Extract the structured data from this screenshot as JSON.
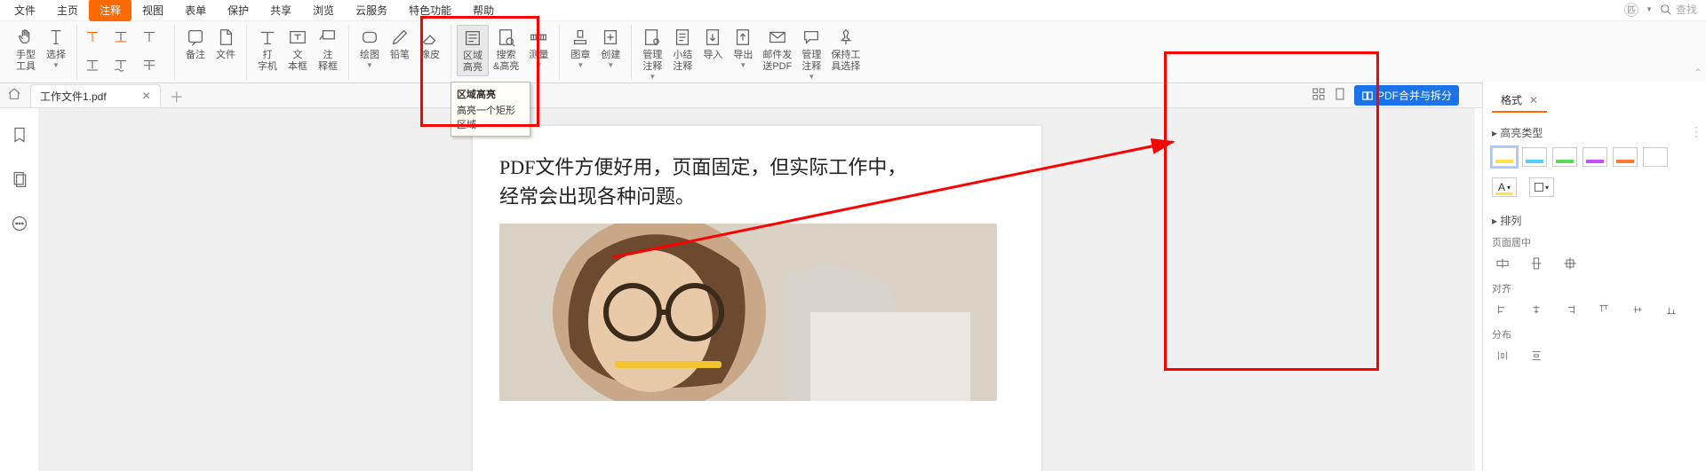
{
  "menu": {
    "items": [
      "文件",
      "主页",
      "注释",
      "视图",
      "表单",
      "保护",
      "共享",
      "浏览",
      "云服务",
      "特色功能",
      "帮助"
    ],
    "active_index": 2
  },
  "search": {
    "placeholder": "查找",
    "zoom_icon_label": "匹"
  },
  "ribbon": {
    "groups": [
      {
        "buttons": [
          {
            "name": "hand-tool",
            "label": "手型\n工具"
          },
          {
            "name": "select-tool",
            "label": "选择",
            "dropdown": true
          }
        ]
      },
      {
        "buttons": [
          {
            "name": "text-highlight-1",
            "label": ""
          },
          {
            "name": "text-highlight-2",
            "label": ""
          },
          {
            "name": "text-highlight-3",
            "label": ""
          },
          {
            "name": "text-underline-1",
            "label": ""
          },
          {
            "name": "text-underline-2",
            "label": ""
          },
          {
            "name": "text-strikethrough",
            "label": ""
          }
        ],
        "compact": true
      },
      {
        "buttons": [
          {
            "name": "note",
            "label": "备注"
          },
          {
            "name": "file-attach",
            "label": "文件"
          }
        ]
      },
      {
        "buttons": [
          {
            "name": "typewriter",
            "label": "打\n字机"
          },
          {
            "name": "textbox",
            "label": "文\n本框"
          },
          {
            "name": "callout",
            "label": "注\n释框"
          }
        ]
      },
      {
        "buttons": [
          {
            "name": "drawing",
            "label": "绘图",
            "dropdown": true
          },
          {
            "name": "pencil",
            "label": "铅笔"
          },
          {
            "name": "eraser",
            "label": "橡皮"
          }
        ]
      },
      {
        "buttons": [
          {
            "name": "area-highlight",
            "label": "区域\n高亮",
            "active": true
          },
          {
            "name": "search-highlight",
            "label": "搜索\n&高亮"
          },
          {
            "name": "measure",
            "label": "测量",
            "dropdown": true
          }
        ]
      },
      {
        "buttons": [
          {
            "name": "stamp",
            "label": "图章",
            "dropdown": true
          },
          {
            "name": "create",
            "label": "创建",
            "dropdown": true
          }
        ]
      },
      {
        "buttons": [
          {
            "name": "manage-comments",
            "label": "管理\n注释",
            "dropdown": true
          },
          {
            "name": "summarize-comments",
            "label": "小结\n注释"
          },
          {
            "name": "import",
            "label": "导入"
          },
          {
            "name": "export",
            "label": "导出",
            "dropdown": true
          },
          {
            "name": "email-pdf",
            "label": "邮件发\n送PDF"
          },
          {
            "name": "manage-comments-2",
            "label": "管理\n注释",
            "dropdown": true
          },
          {
            "name": "keep-tool",
            "label": "保持工\n具选择"
          }
        ]
      }
    ]
  },
  "tooltip": {
    "title": "区域高亮",
    "desc": "高亮一个矩形区域"
  },
  "tabs": {
    "open": [
      {
        "title": "工作文件1.pdf"
      }
    ]
  },
  "tabbar_right": {
    "merge_btn": "PDF合并与拆分"
  },
  "doc": {
    "line1": "PDF文件方便好用，页面固定，但实际工作中，",
    "line2": "经常会出现各种问题。"
  },
  "right_panel": {
    "tab_label": "格式",
    "section_highlight": "高亮类型",
    "colors": [
      "#ffe24d",
      "#52d0ff",
      "#5bd95b",
      "#c44dff",
      "#ff7a2e",
      "#ffffff"
    ],
    "section_arrange": "排列",
    "sub_center": "页面居中",
    "sub_align": "对齐",
    "sub_distribute": "分布"
  }
}
